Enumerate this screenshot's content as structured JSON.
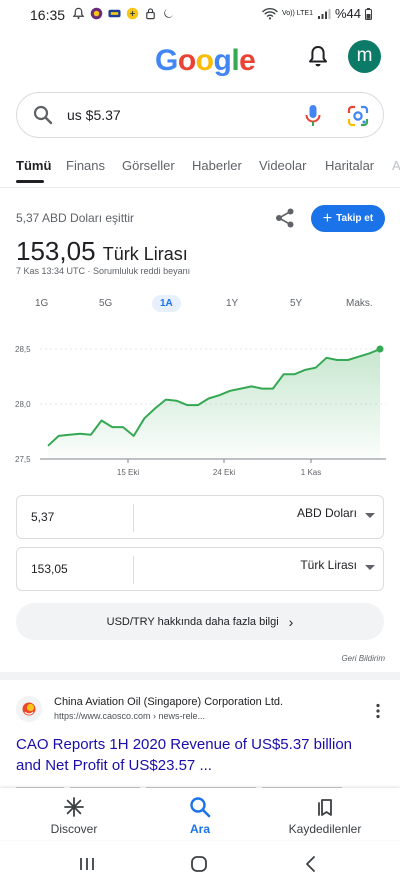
{
  "status_bar": {
    "time": "16:35",
    "network": "Vo)) LTE1",
    "battery": "%44"
  },
  "header": {
    "logo_letters": [
      {
        "ch": "G",
        "color": "#4285F4"
      },
      {
        "ch": "o",
        "color": "#EA4335"
      },
      {
        "ch": "o",
        "color": "#FBBC05"
      },
      {
        "ch": "g",
        "color": "#4285F4"
      },
      {
        "ch": "l",
        "color": "#34A853"
      },
      {
        "ch": "e",
        "color": "#EA4335"
      }
    ],
    "avatar_letter": "m",
    "avatar_color": "#0b7a67"
  },
  "search": {
    "query": "us $5.37"
  },
  "tabs": [
    "Tümü",
    "Finans",
    "Görseller",
    "Haberler",
    "Videolar",
    "Haritalar",
    "A"
  ],
  "finance": {
    "equiv_label": "5,37 ABD Doları eşittir",
    "follow_label": "Takip et",
    "value": "153,05",
    "unit": "Türk Lirası",
    "timestamp": "7 Kas 13:34 UTC · Sorumluluk reddi beyanı",
    "ranges": [
      "1G",
      "5G",
      "1A",
      "1Y",
      "5Y",
      "Maks."
    ],
    "active_range": "1A",
    "accent": "#1a73e8",
    "line_color": "#34A853"
  },
  "chart_data": {
    "type": "area",
    "y_ticks": [
      "28,5",
      "28,0",
      "27,5"
    ],
    "x_ticks": [
      "15 Eki",
      "24 Eki",
      "1 Kas"
    ],
    "ylim": [
      27.5,
      28.5
    ],
    "values": [
      27.62,
      27.71,
      27.72,
      27.73,
      27.72,
      27.85,
      27.79,
      27.79,
      27.71,
      27.87,
      27.96,
      28.04,
      28.03,
      27.99,
      27.99,
      28.05,
      28.08,
      28.12,
      28.14,
      28.16,
      28.14,
      28.14,
      28.27,
      28.27,
      28.31,
      28.33,
      28.42,
      28.4,
      28.4,
      28.43,
      28.46,
      28.5
    ]
  },
  "converter": {
    "from_value": "5,37",
    "from_currency": "ABD Doları",
    "to_value": "153,05",
    "to_currency": "Türk Lirası"
  },
  "more_info_label": "USD/TRY hakkında daha fazla bilgi",
  "feedback_label": "Geri Bildirim",
  "result": {
    "site_name": "China Aviation Oil (Singapore) Corporation Ltd.",
    "url": "https://www.caosco.com › news-rele...",
    "title": "CAO Reports 1H 2020 Revenue of US$5.37 billion and Net Profit of US$23.57 ..."
  },
  "bottom_nav": [
    {
      "label": "Discover",
      "icon": "asterisk-icon"
    },
    {
      "label": "Ara",
      "icon": "search-icon"
    },
    {
      "label": "Kaydedilenler",
      "icon": "bookmarks-icon"
    }
  ]
}
